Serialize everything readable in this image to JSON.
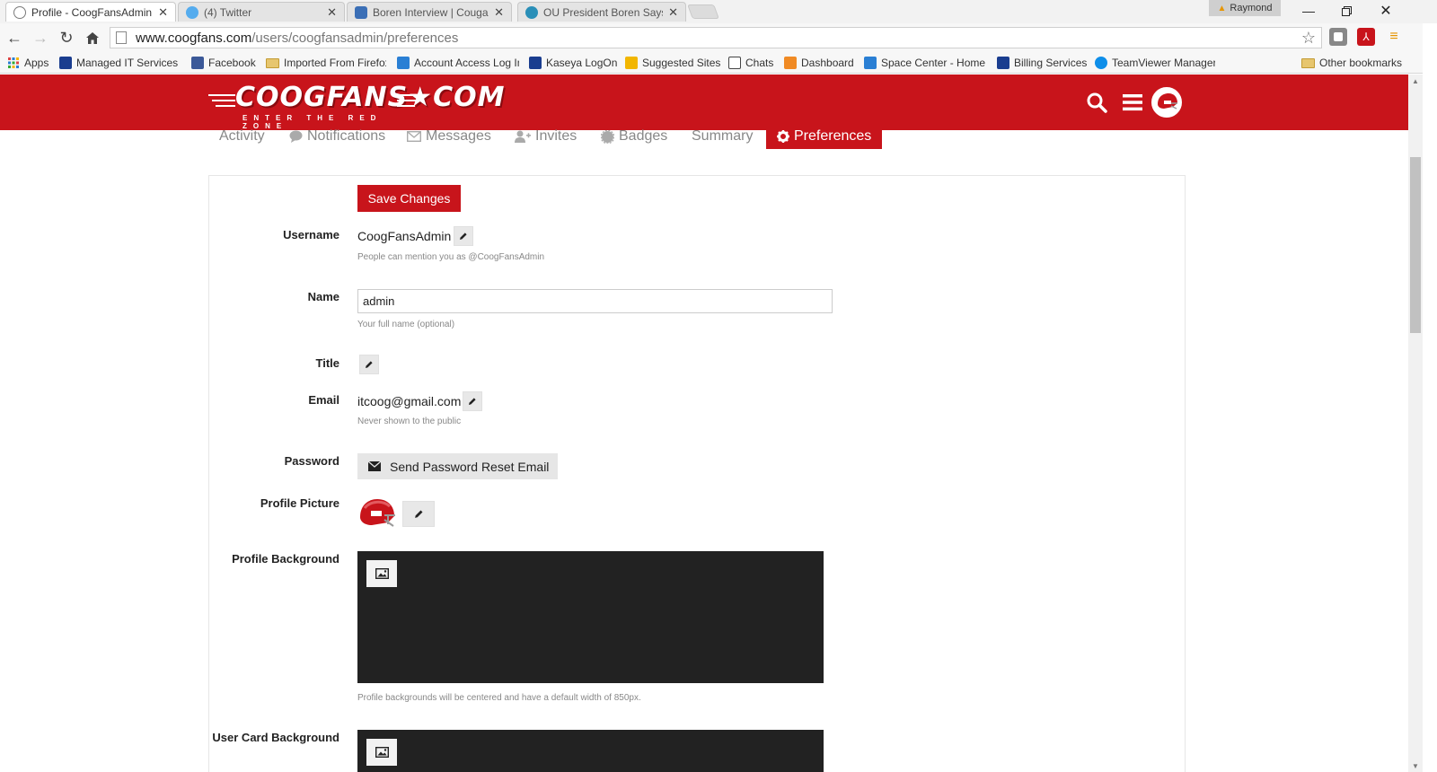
{
  "browser": {
    "tabs": [
      {
        "title": "Profile - CoogFansAdmin",
        "close": "✕",
        "active": true,
        "icon_color": "#7a7a7a"
      },
      {
        "title": "(4) Twitter",
        "close": "✕",
        "active": false,
        "icon_color": "#55acee"
      },
      {
        "title": "Boren Interview | Cougars",
        "close": "✕",
        "active": false,
        "icon_color": "#3b6fb6"
      },
      {
        "title": "OU President Boren Says",
        "close": "✕",
        "active": false,
        "icon_color": "#2a8fb8"
      }
    ],
    "profile_name": "Raymond",
    "url_host": "www.coogfans.com",
    "url_path": "/users/coogfansadmin/preferences",
    "bookmarks": [
      {
        "label": "Apps",
        "icon": "apps-icon",
        "color": "#d44"
      },
      {
        "label": "Managed IT Services",
        "icon": "kaseya-icon",
        "color": "#1a3d8f"
      },
      {
        "label": "Facebook",
        "icon": "facebook-icon",
        "color": "#3b5998"
      },
      {
        "label": "Imported From Firefox",
        "icon": "folder-icon",
        "color": "#e7c66f"
      },
      {
        "label": "Account Access Log In",
        "icon": "calendar-icon",
        "color": "#2a7fd4"
      },
      {
        "label": "Kaseya LogOn",
        "icon": "kaseya-icon",
        "color": "#1a3d8f"
      },
      {
        "label": "Suggested Sites",
        "icon": "bing-icon",
        "color": "#f2b600"
      },
      {
        "label": "Chats",
        "icon": "lc-icon",
        "color": "#444"
      },
      {
        "label": "Dashboard",
        "icon": "dashboard-icon",
        "color": "#f08a24"
      },
      {
        "label": "Space Center - Home",
        "icon": "cr-icon",
        "color": "#2a7fd4"
      },
      {
        "label": "Billing Services",
        "icon": "billing-icon",
        "color": "#1a3d8f"
      },
      {
        "label": "TeamViewer Manager",
        "icon": "teamviewer-icon",
        "color": "#0e8ee9"
      },
      {
        "label": "Other bookmarks",
        "icon": "folder-icon",
        "color": "#e7c66f"
      }
    ]
  },
  "site": {
    "logo_text": "COOGFANS★COM",
    "logo_tagline": "ENTER THE RED ZONE",
    "brand_color": "#c8141b"
  },
  "user_nav": [
    {
      "label": "Activity",
      "icon": ""
    },
    {
      "label": "Notifications",
      "icon": "comment-icon"
    },
    {
      "label": "Messages",
      "icon": "envelope-icon"
    },
    {
      "label": "Invites",
      "icon": "user-plus-icon"
    },
    {
      "label": "Badges",
      "icon": "certificate-icon"
    },
    {
      "label": "Summary",
      "icon": ""
    },
    {
      "label": "Preferences",
      "icon": "gear-icon",
      "active": true
    }
  ],
  "prefs": {
    "save_label": "Save Changes",
    "username": {
      "label": "Username",
      "value": "CoogFansAdmin",
      "hint": "People can mention you as @CoogFansAdmin"
    },
    "name": {
      "label": "Name",
      "value": "admin",
      "hint": "Your full name (optional)"
    },
    "title": {
      "label": "Title"
    },
    "email": {
      "label": "Email",
      "value": "itcoog@gmail.com",
      "hint": "Never shown to the public"
    },
    "password": {
      "label": "Password",
      "button": "Send Password Reset Email"
    },
    "profile_picture": {
      "label": "Profile Picture"
    },
    "profile_background": {
      "label": "Profile Background",
      "hint": "Profile backgrounds will be centered and have a default width of 850px."
    },
    "user_card_background": {
      "label": "User Card Background"
    }
  }
}
